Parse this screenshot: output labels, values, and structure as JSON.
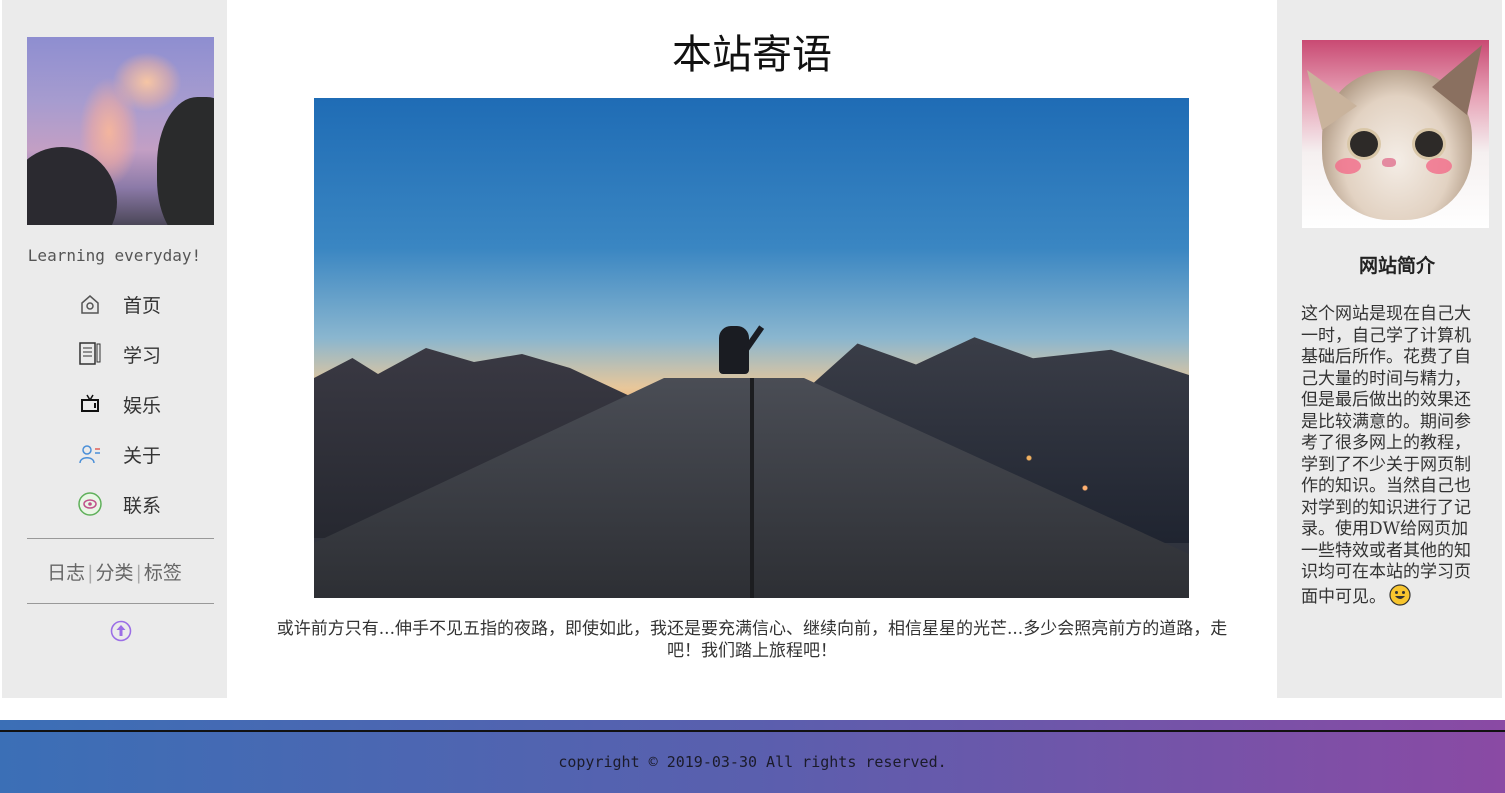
{
  "left_sidebar": {
    "slogan": "Learning everyday!",
    "nav": [
      {
        "label": "首页",
        "icon": "home-icon"
      },
      {
        "label": "学习",
        "icon": "notebook-icon"
      },
      {
        "label": "娱乐",
        "icon": "tv-icon"
      },
      {
        "label": "关于",
        "icon": "user-icon"
      },
      {
        "label": "联系",
        "icon": "contact-icon"
      }
    ],
    "meta_links": [
      "日志",
      "分类",
      "标签"
    ],
    "back_to_top_icon": "arrow-up-circle-icon"
  },
  "main": {
    "title": "本站寄语",
    "caption": "或许前方只有...伸手不见五指的夜路，即使如此，我还是要充满信心、继续向前，相信星星的光芒...多少会照亮前方的道路，走吧！我们踏上旅程吧！"
  },
  "right_sidebar": {
    "title": "网站简介",
    "text": "这个网站是现在自己大一时，自己学了计算机基础后所作。花费了自己大量的时间与精力，但是最后做出的效果还是比较满意的。期间参考了很多网上的教程，学到了不少关于网页制作的知识。当然自己也对学到的知识进行了记录。使用DW给网页加一些特效或者其他的知识均可在本站的学习页面中可见。",
    "emoji_icon": "smile-emoji-icon"
  },
  "footer": {
    "copyright": "copyright © 2019-03-30 All rights reserved."
  },
  "colors": {
    "sidebar_bg": "#ebebeb",
    "footer_gradient_start": "#3b6fb6",
    "footer_gradient_end": "#8a4aa4",
    "accent_purple": "#9b6ee6"
  }
}
